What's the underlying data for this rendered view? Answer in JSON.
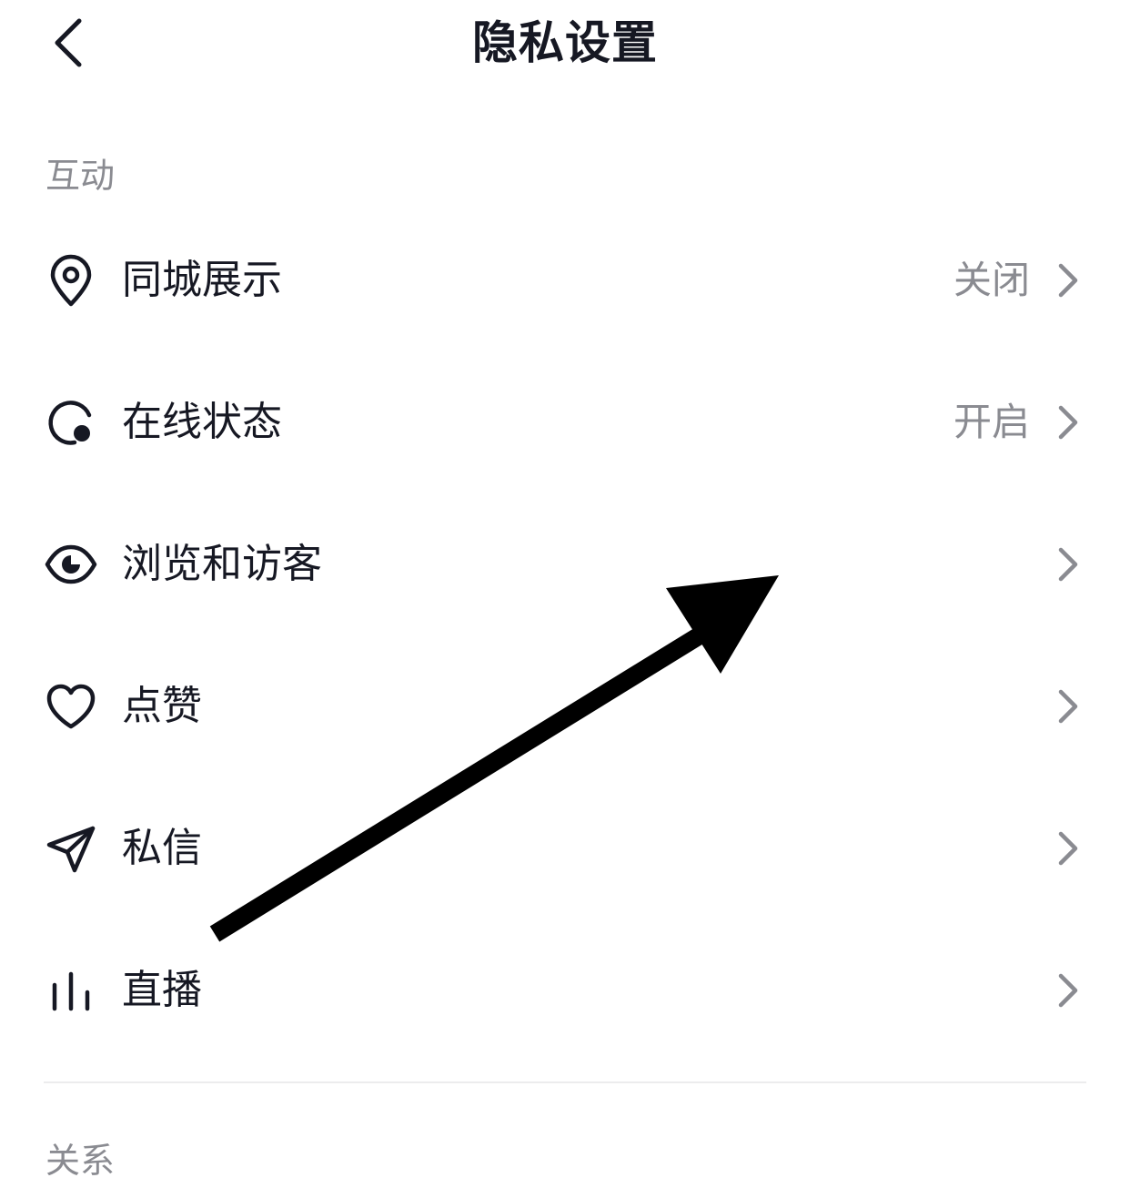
{
  "header": {
    "title": "隐私设置",
    "back_icon": "chevron-left-icon"
  },
  "sections": [
    {
      "title": "互动",
      "items": [
        {
          "label": "同城展示",
          "value": "关闭",
          "icon": "location-pin-icon"
        },
        {
          "label": "在线状态",
          "value": "开启",
          "icon": "online-status-icon"
        },
        {
          "label": "浏览和访客",
          "value": "",
          "icon": "eye-icon"
        },
        {
          "label": "点赞",
          "value": "",
          "icon": "heart-icon"
        },
        {
          "label": "私信",
          "value": "",
          "icon": "paper-plane-icon"
        },
        {
          "label": "直播",
          "value": "",
          "icon": "live-bars-icon"
        }
      ]
    },
    {
      "title": "关系",
      "items": []
    }
  ],
  "colors": {
    "text_primary": "#161823",
    "text_secondary": "#8a8b91",
    "divider": "#ececed",
    "annotation_arrow": "#000000"
  }
}
